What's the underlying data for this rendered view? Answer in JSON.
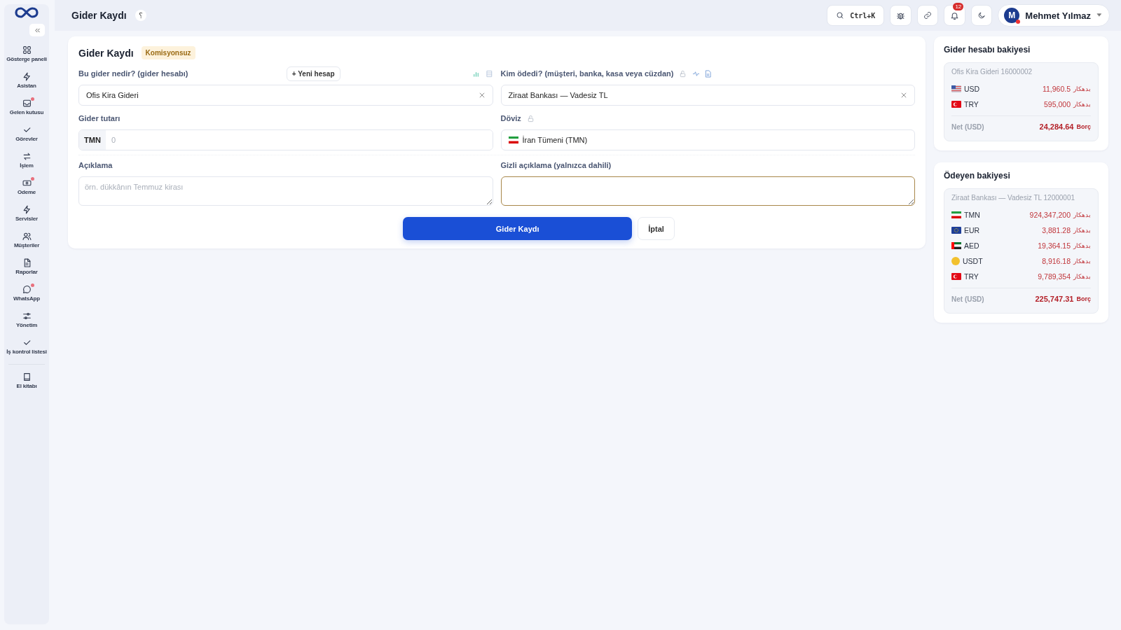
{
  "sidebar": {
    "items": [
      {
        "label": "Gösterge paneli",
        "dot": false
      },
      {
        "label": "Asistan",
        "dot": false
      },
      {
        "label": "Gelen kutusu",
        "dot": true
      },
      {
        "label": "Görevler",
        "dot": false
      },
      {
        "label": "İşlem",
        "dot": false
      },
      {
        "label": "Odeme",
        "dot": true
      },
      {
        "label": "Servisler",
        "dot": false
      },
      {
        "label": "Müşteriler",
        "dot": false
      },
      {
        "label": "Raporlar",
        "dot": false
      },
      {
        "label": "WhatsApp",
        "dot": true
      },
      {
        "label": "Yönetim",
        "dot": false
      },
      {
        "label": "İş kontrol listesi",
        "dot": false
      }
    ],
    "footer_items": [
      {
        "label": "El kitabı",
        "dot": false
      }
    ]
  },
  "header": {
    "title": "Gider Kaydı",
    "help": "؟",
    "search_shortcut": "Ctrl+K",
    "notification_count": "12",
    "user": {
      "initial": "M",
      "name": "Mehmet Yılmaz"
    }
  },
  "form": {
    "title": "Gider Kaydı",
    "badge": "Komisyonsuz",
    "account": {
      "label": "Bu gider nedir? (gider hesabı)",
      "new_button": "+ Yeni hesap",
      "value": "Ofis Kira Gideri"
    },
    "payer": {
      "label": "Kim ödedi? (müşteri, banka, kasa veya cüzdan)",
      "value": "Ziraat Bankası — Vadesiz TL"
    },
    "amount": {
      "label": "Gider tutarı",
      "currency": "TMN",
      "placeholder": "0"
    },
    "currency": {
      "label": "Döviz",
      "kind": "ir",
      "value": "İran Tümeni (TMN)"
    },
    "description": {
      "label": "Açıklama",
      "placeholder": "örn. dükkânın Temmuz kirası"
    },
    "private_note": {
      "label": "Gizli açıklama (yalnızca dahili)"
    },
    "submit": "Gider Kaydı",
    "cancel": "İptal"
  },
  "balances": [
    {
      "title": "Gider hesabı bakiyesi",
      "account": "Ofis Kira Gideri 16000002",
      "rows": [
        {
          "kind": "us",
          "code": "USD",
          "amount": "11,960.5",
          "side": "بدهکار"
        },
        {
          "kind": "tr",
          "code": "TRY",
          "amount": "595,000",
          "side": "بدهکار"
        }
      ],
      "net_label": "Net (USD)",
      "net": "24,284.64",
      "net_side": "Borç"
    },
    {
      "title": "Ödeyen bakiyesi",
      "account": "Ziraat Bankası — Vadesiz TL 12000001",
      "rows": [
        {
          "kind": "ir",
          "code": "TMN",
          "amount": "924,347,200",
          "side": "بدهکار"
        },
        {
          "kind": "eu",
          "code": "EUR",
          "amount": "3,881.28",
          "side": "بدهکار"
        },
        {
          "kind": "ae",
          "code": "AED",
          "amount": "19,364.15",
          "side": "بدهکار"
        },
        {
          "kind": "coin",
          "code": "USDT",
          "amount": "8,916.18",
          "side": "بدهکار"
        },
        {
          "kind": "tr",
          "code": "TRY",
          "amount": "9,789,354",
          "side": "بدهکار"
        }
      ],
      "net_label": "Net (USD)",
      "net": "225,747.31",
      "net_side": "Borç"
    }
  ]
}
